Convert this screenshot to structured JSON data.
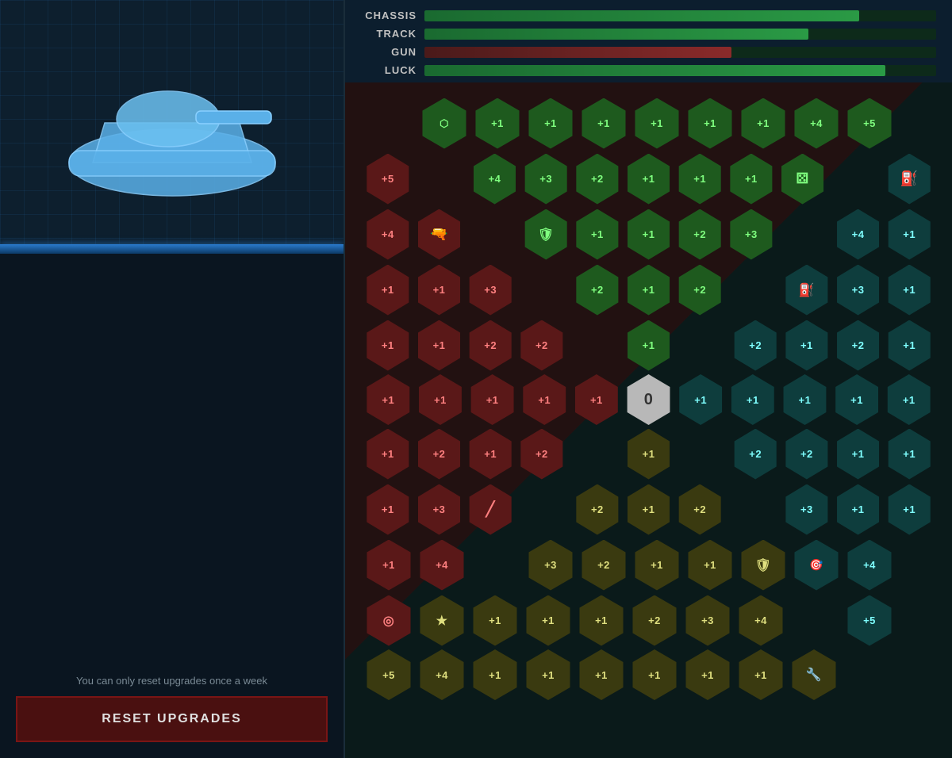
{
  "left_panel": {
    "reset_notice": "You can only reset upgrades once a week",
    "reset_btn_label": "RESET UPGRADES"
  },
  "stat_bars": {
    "labels": [
      "CHASSIS",
      "TRACK",
      "GUN",
      "LUCK"
    ],
    "widths": [
      "82%",
      "74%",
      "58%",
      "91%"
    ]
  },
  "grid": {
    "rows": [
      [
        "icon:chip",
        "+1",
        "+1",
        "+1",
        "+1",
        "+1",
        "+1",
        "+4",
        "+5",
        "empty"
      ],
      [
        "+5",
        "+4",
        "+3",
        "+2",
        "+1",
        "+1",
        "+1",
        "icon:dice",
        "empty",
        "icon:fuel-can"
      ],
      [
        "+4",
        "icon:gun",
        "icon:shield",
        "+1",
        "+1",
        "+2",
        "+3",
        "empty",
        "+4",
        "+1"
      ],
      [
        "+1",
        "+1",
        "+3",
        "empty",
        "+2",
        "+1",
        "+2",
        "icon:pump",
        "+3",
        "+1"
      ],
      [
        "+1",
        "+1",
        "+2",
        "+2",
        "empty",
        "+1",
        "empty",
        "+2",
        "+1",
        "+2",
        "+1"
      ],
      [
        "+1",
        "+1",
        "+1",
        "+1",
        "+1",
        "0",
        "+1",
        "+1",
        "+1",
        "+1",
        "+1"
      ],
      [
        "+1",
        "+2",
        "+1",
        "+2",
        "empty",
        "+1",
        "empty",
        "+2",
        "+2",
        "+1",
        "+1"
      ],
      [
        "+1",
        "+3",
        "icon:slash",
        "empty",
        "+2",
        "+1",
        "+2",
        "empty",
        "+3",
        "+1",
        "+1"
      ],
      [
        "+1",
        "+4",
        "empty",
        "+3",
        "+2",
        "+1",
        "+1",
        "icon:shield2",
        "icon:tank2",
        "+4"
      ],
      [
        "icon:target",
        "icon:star",
        "+1",
        "+1",
        "+1",
        "+2",
        "+3",
        "+4",
        "empty",
        "+5"
      ],
      [
        "+5",
        "+4",
        "+1",
        "+1",
        "+1",
        "+1",
        "+1",
        "+1",
        "icon:wrench",
        "empty"
      ]
    ]
  }
}
